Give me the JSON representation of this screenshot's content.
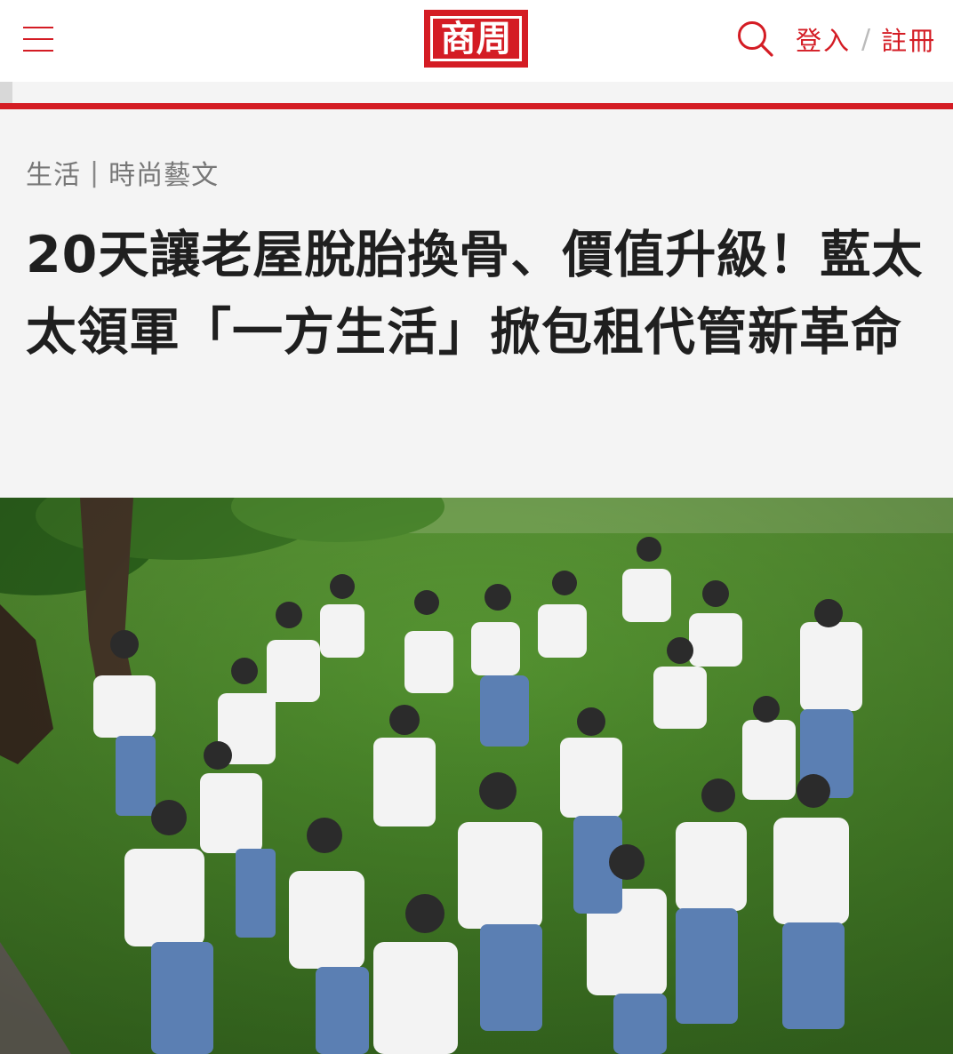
{
  "header": {
    "logo_text": "商周",
    "login_label": "登入",
    "divider": "/",
    "register_label": "註冊",
    "brand_color": "#d41c24"
  },
  "article": {
    "category_primary": "生活",
    "category_separator": "|",
    "category_secondary": "時尚藝文",
    "title": "20天讓老屋脫胎換骨、價值升級！藍太太領軍「一方生活」掀包租代管新革命"
  },
  "icons": {
    "menu": "hamburger-menu-icon",
    "search": "search-icon"
  }
}
